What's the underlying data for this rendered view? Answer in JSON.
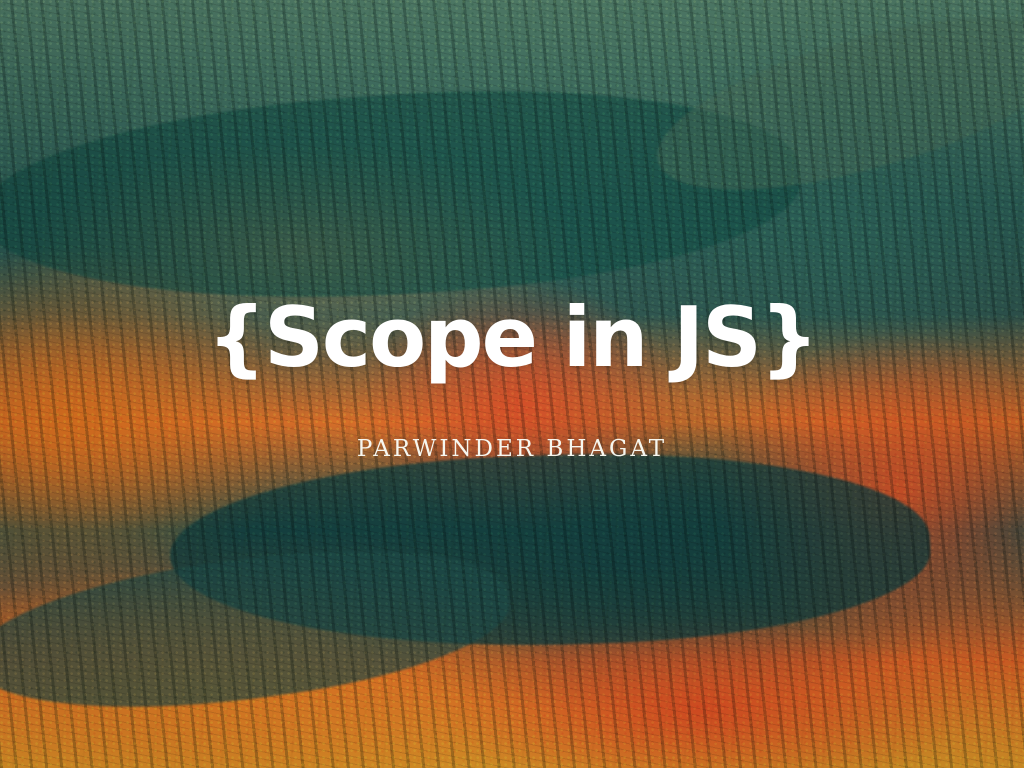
{
  "slide": {
    "title": "{Scope in JS}",
    "author": "PARWINDER BHAGAT"
  },
  "colors": {
    "title_text": "#ffffff",
    "author_text": "#f7f7ef",
    "background_teal": "#2f6760",
    "background_orange": "#f36e2b",
    "background_yellow": "#f2a52c"
  }
}
